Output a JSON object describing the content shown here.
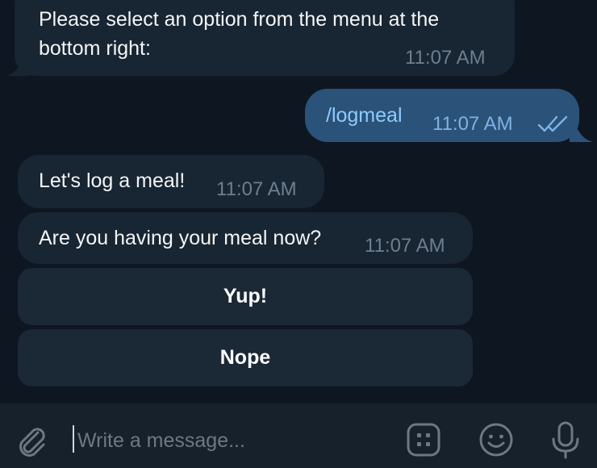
{
  "messages": [
    {
      "text_line1": "Please select an option from the menu at the",
      "text_line2": "bottom right:",
      "time": "11:07 AM"
    },
    {
      "text": "/logmeal",
      "time": "11:07 AM"
    },
    {
      "text": "Let's log a meal!",
      "time": "11:07 AM"
    },
    {
      "text": "Are you having your meal now?",
      "time": "11:07 AM"
    }
  ],
  "inline_buttons": [
    "Yup!",
    "Nope"
  ],
  "composer": {
    "placeholder": "Write a message..."
  },
  "icons": {
    "attach": "paperclip-icon",
    "commands": "bot-commands-icon",
    "emoji": "smile-icon",
    "voice": "microphone-icon",
    "read_receipt": "double-check-icon"
  },
  "colors": {
    "background": "#0e1621",
    "incoming_bubble": "#182533",
    "outgoing_bubble": "#2b5278",
    "composer": "#17212b",
    "command_link": "#8ecbff"
  }
}
